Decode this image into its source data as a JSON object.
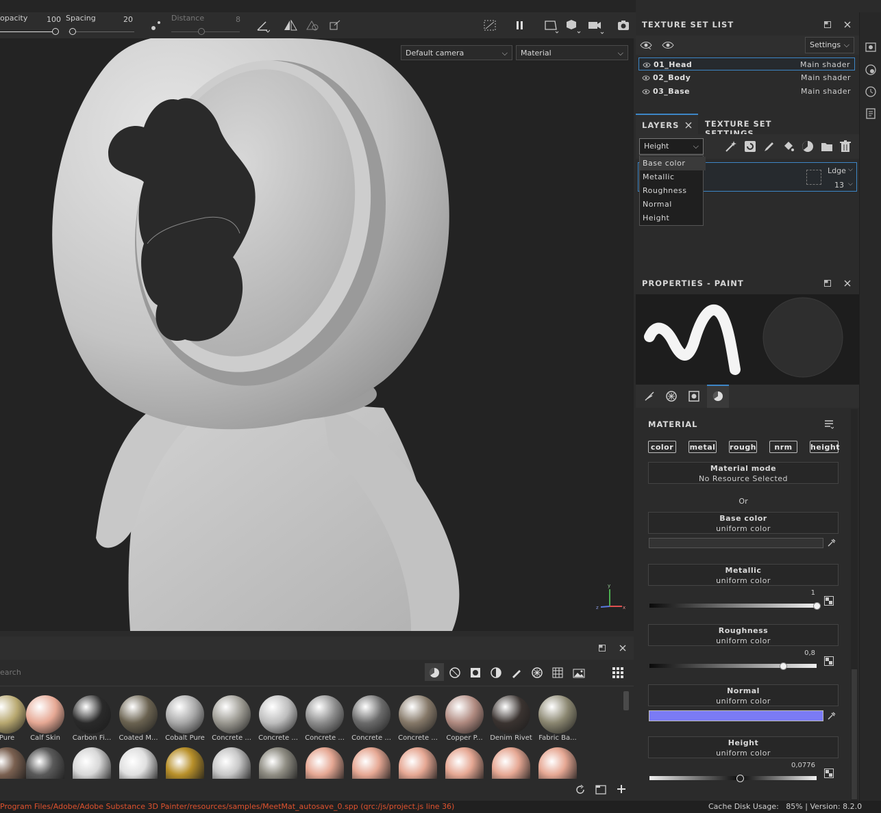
{
  "toolbar": {
    "opacity_label": "opacity",
    "opacity_value": "100",
    "spacing_label": "Spacing",
    "spacing_value": "20",
    "distance_label": "Distance",
    "distance_value": "8"
  },
  "viewport": {
    "camera_select": "Default camera",
    "mode_select": "Material"
  },
  "texture_set_list": {
    "title": "TEXTURE SET LIST",
    "settings_label": "Settings",
    "sets": [
      {
        "name": "01_Head",
        "shader": "Main shader"
      },
      {
        "name": "02_Body",
        "shader": "Main shader"
      },
      {
        "name": "03_Base",
        "shader": "Main shader"
      }
    ]
  },
  "layers": {
    "tab_layers": "LAYERS",
    "tab_tss": "TEXTURE SET SETTINGS",
    "channel_select": "Height",
    "channel_options": [
      "Base color",
      "Metallic",
      "Roughness",
      "Normal",
      "Height"
    ],
    "blend_mode": "Ldge",
    "opacity_value": "13"
  },
  "properties": {
    "title": "PROPERTIES - PAINT",
    "section_title": "MATERIAL",
    "channels": [
      "color",
      "metal",
      "rough",
      "nrm",
      "height"
    ],
    "material_mode_title": "Material mode",
    "material_mode_value": "No Resource Selected",
    "or_label": "Or",
    "base_color_title": "Base color",
    "base_color_sub": "uniform color",
    "metallic_title": "Metallic",
    "metallic_sub": "uniform color",
    "metallic_value": "1",
    "metallic_level": 1.0,
    "roughness_title": "Roughness",
    "roughness_sub": "uniform color",
    "roughness_value": "0,8",
    "roughness_level": 0.8,
    "normal_title": "Normal",
    "normal_sub": "uniform color",
    "normal_color": "#7b7bf5",
    "height_title": "Height",
    "height_sub": "uniform color",
    "height_value": "0,0776",
    "height_level": 0.54
  },
  "shelf": {
    "search_placeholder": "earch",
    "row1": [
      {
        "label": "Pure",
        "color": "#b8a870"
      },
      {
        "label": "Calf Skin",
        "color": "#e6a894"
      },
      {
        "label": "Carbon Fi...",
        "color": "#2a2a2a"
      },
      {
        "label": "Coated M...",
        "color": "#6a6250"
      },
      {
        "label": "Cobalt Pure",
        "color": "#a8a8a8"
      },
      {
        "label": "Concrete ...",
        "color": "#9a9890"
      },
      {
        "label": "Concrete ...",
        "color": "#bdbdbd"
      },
      {
        "label": "Concrete ...",
        "color": "#8c8c8c"
      },
      {
        "label": "Concrete ...",
        "color": "#6a6a6a"
      },
      {
        "label": "Concrete ...",
        "color": "#857868"
      },
      {
        "label": "Copper P...",
        "color": "#b08a80"
      },
      {
        "label": "Denim Rivet",
        "color": "#3a3330"
      },
      {
        "label": "Fabric Ba...",
        "color": "#8a8670"
      }
    ],
    "row2_colors": [
      "#7a6050",
      "#5a5a5a",
      "#d8d8d8",
      "#e0e0e0",
      "#b8902a",
      "#c8c8c8",
      "#908e84",
      "#e6a894",
      "#e6a894",
      "#e6a894",
      "#e6a894",
      "#e6a894",
      "#e6a894"
    ]
  },
  "status": {
    "path": "Program Files/Adobe/Adobe Substance 3D Painter/resources/samples/MeetMat_autosave_0.spp (qrc:/js/project.js line 36)",
    "cache": "Cache Disk Usage:   85% | Version: 8.2.0"
  }
}
